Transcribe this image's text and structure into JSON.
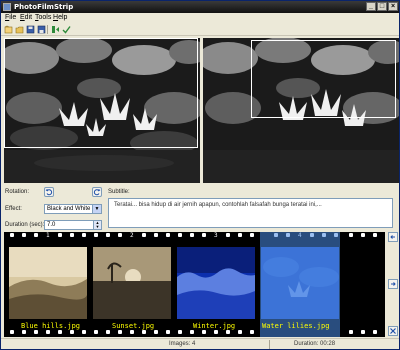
{
  "window": {
    "title": "PhotoFilmStrip"
  },
  "menu": [
    {
      "label": "File",
      "mnemonic": "F",
      "rest": "ile"
    },
    {
      "label": "Edit",
      "mnemonic": "E",
      "rest": "dit"
    },
    {
      "label": "Tools",
      "mnemonic": "T",
      "rest": "ools"
    },
    {
      "label": "Help",
      "mnemonic": "H",
      "rest": "elp"
    }
  ],
  "controls": {
    "rotation_label": "Rotation:",
    "effect_label": "Effect:",
    "effect_value": "Black and White",
    "duration_label": "Duration (sec):",
    "duration_value": "7.0",
    "subtitle_label": "Subtitle:",
    "subtitle_text": "Teratai... bisa hidup di air jernih apapun, contohlah falsafah bunga teratai ini,..."
  },
  "filmstrip": {
    "frames": [
      {
        "number": "1",
        "filename": "Blue hills.jpg"
      },
      {
        "number": "2",
        "filename": "Sunset.jpg"
      },
      {
        "number": "3",
        "filename": "Winter.jpg"
      },
      {
        "number": "4",
        "filename": "Water lilies.jpg"
      }
    ],
    "selected_index": 3
  },
  "status": {
    "images": "Images: 4",
    "duration": "Duration: 00:28"
  },
  "colors": {
    "selection": "#4a8ce6",
    "filename_text": "#ffff00",
    "titlebar": "#1a1a1a"
  }
}
